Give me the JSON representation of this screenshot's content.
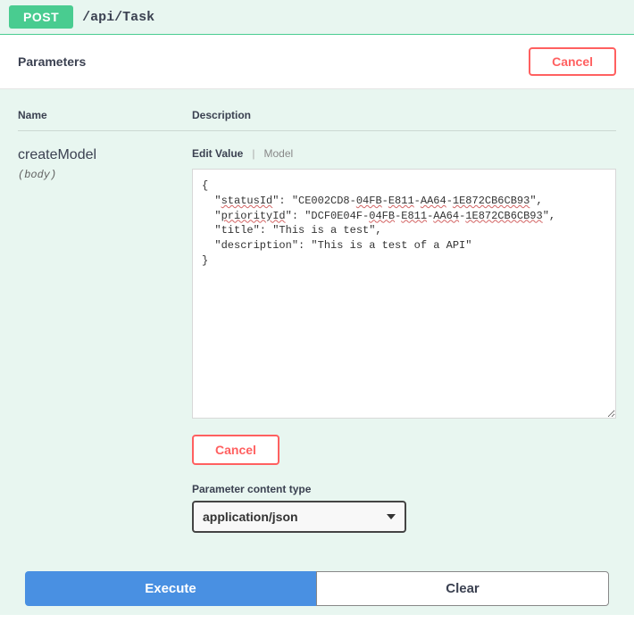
{
  "header": {
    "method": "POST",
    "endpoint": "/api/Task"
  },
  "parameters": {
    "title": "Parameters",
    "cancel_label": "Cancel",
    "columns": {
      "name": "Name",
      "description": "Description"
    },
    "row": {
      "name": "createModel",
      "in": "(body)",
      "tab_edit": "Edit Value",
      "tab_model": "Model",
      "body_value": "{\n  \"statusId\": \"CE002CD8-04FB-E811-AA64-1E872CB6CB93\",\n  \"priorityId\": \"DCF0E04F-04FB-E811-AA64-1E872CB6CB93\",\n  \"title\": \"This is a test\",\n  \"description\": \"This is a test of a API\"\n}",
      "body_display": "{\n  \"<sp>statusId</sp>\": \"CE002CD8-<sp>04FB</sp>-<sp>E811</sp>-<sp>AA64</sp>-<sp>1E872CB6CB93</sp>\",\n  \"<sp>priorityId</sp>\": \"DCF0E04F-<sp>04FB</sp>-<sp>E811</sp>-<sp>AA64</sp>-<sp>1E872CB6CB93</sp>\",\n  \"title\": \"This is a test\",\n  \"description\": \"This is a test of a API\"\n}",
      "cancel2_label": "Cancel",
      "content_type_label": "Parameter content type",
      "content_type_value": "application/json"
    }
  },
  "actions": {
    "execute": "Execute",
    "clear": "Clear"
  }
}
